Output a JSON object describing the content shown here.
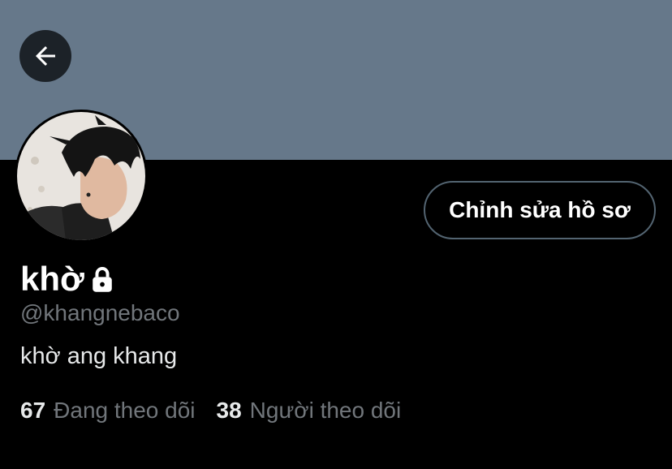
{
  "colors": {
    "banner": "#66788a",
    "background": "#000000",
    "secondary_text": "#71767b",
    "button_border": "#536471"
  },
  "header": {
    "back_icon": "arrow-left-icon"
  },
  "profile": {
    "avatar_icon": "profile-photo",
    "edit_button_label": "Chỉnh sửa hồ sơ",
    "display_name": "khờ",
    "protected_icon": "lock-icon",
    "handle": "@khangnebaco",
    "bio": "khờ ang khang",
    "stats": {
      "following_count": "67",
      "following_label": "Đang theo dõi",
      "followers_count": "38",
      "followers_label": "Người theo dõi"
    }
  }
}
